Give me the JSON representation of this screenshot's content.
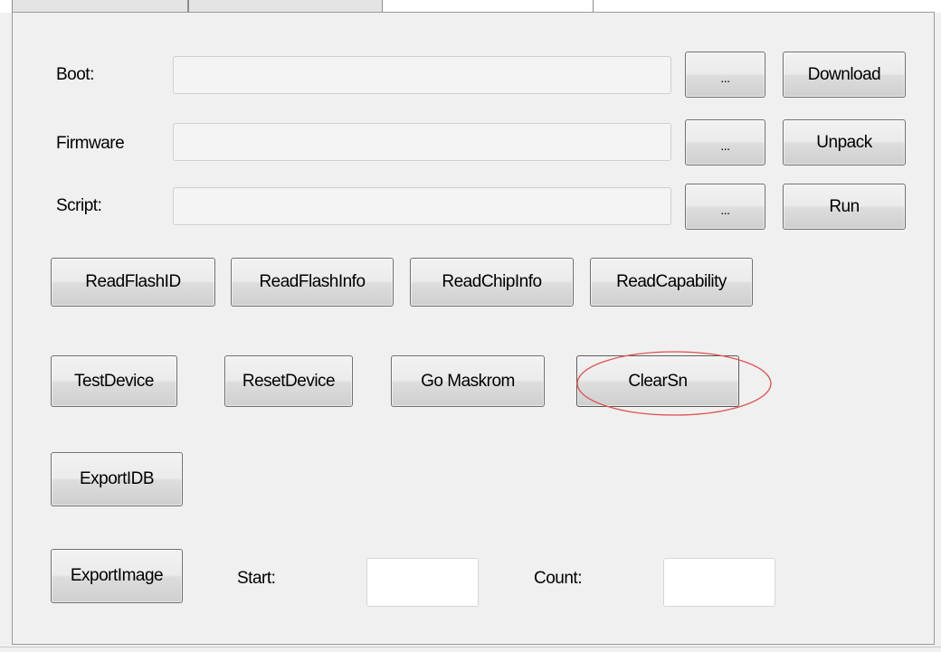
{
  "rows": {
    "boot": {
      "label": "Boot:",
      "value": "",
      "browse_label": "...",
      "action_label": "Download"
    },
    "firmware": {
      "label": "Firmware",
      "value": "",
      "browse_label": "...",
      "action_label": "Unpack"
    },
    "script": {
      "label": "Script:",
      "value": "",
      "browse_label": "...",
      "action_label": "Run"
    }
  },
  "buttons": {
    "read_flash_id": "ReadFlashID",
    "read_flash_info": "ReadFlashInfo",
    "read_chip_info": "ReadChipInfo",
    "read_capability": "ReadCapability",
    "test_device": "TestDevice",
    "reset_device": "ResetDevice",
    "go_maskrom": "Go Maskrom",
    "clear_sn": "ClearSn",
    "export_idb": "ExportIDB",
    "export_image": "ExportImage"
  },
  "export_range": {
    "start_label": "Start:",
    "start_value": "",
    "count_label": "Count:",
    "count_value": ""
  },
  "annotation": {
    "highlight_color": "#e05050",
    "highlighted": "ClearSn"
  },
  "colors": {
    "panel_bg": "#f0f0f0",
    "button_border": "#707070"
  }
}
